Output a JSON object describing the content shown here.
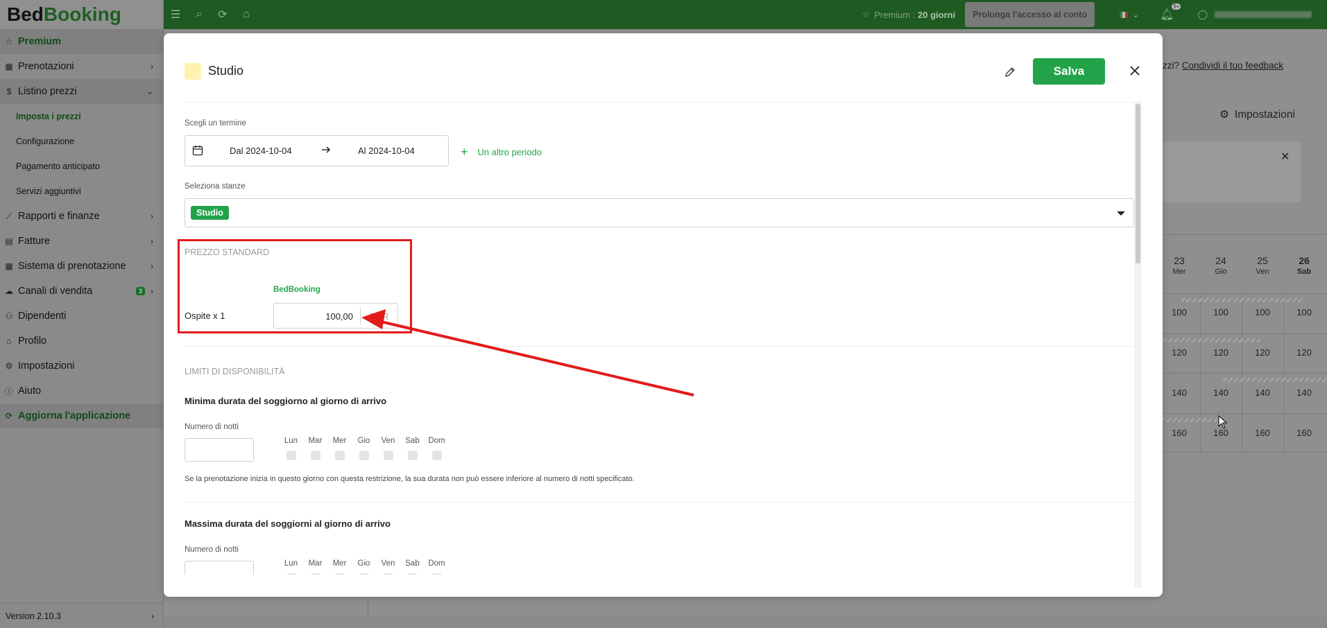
{
  "app": {
    "logo_part1": "Bed",
    "logo_part2": "Booking"
  },
  "sidebar": {
    "premium": "Premium",
    "items": [
      {
        "label": "Prenotazioni"
      },
      {
        "label": "Listino prezzi"
      },
      {
        "label": "Rapporti e finanze"
      },
      {
        "label": "Fatture"
      },
      {
        "label": "Sistema di prenotazione"
      },
      {
        "label": "Canali di vendita",
        "badge": "3"
      },
      {
        "label": "Dipendenti"
      },
      {
        "label": "Profilo"
      },
      {
        "label": "Impostazioni"
      },
      {
        "label": "Aiuto"
      }
    ],
    "subitems": [
      {
        "label": "Imposta i prezzi"
      },
      {
        "label": "Configurazione"
      },
      {
        "label": "Pagamento anticipato"
      },
      {
        "label": "Servizi aggiuntivi"
      }
    ],
    "update_app": "Aggiorna l'applicazione",
    "version": "Version 2.10.3"
  },
  "topbar": {
    "premium_prefix": "Premium : ",
    "premium_days": "20 giorni",
    "prolonga_button": "Prolunga l'accesso al conto",
    "notif_badge": "9+"
  },
  "background": {
    "feedback_prefix": "zzi? ",
    "feedback_link": "Condividi il tuo feedback",
    "settings": "Impostazioni",
    "days": [
      {
        "num": "23",
        "dow": "Mer"
      },
      {
        "num": "24",
        "dow": "Gio"
      },
      {
        "num": "25",
        "dow": "Ven"
      },
      {
        "num": "26",
        "dow": "Sab"
      }
    ],
    "rows": [
      [
        "100",
        "100",
        "100",
        "100"
      ],
      [
        "120",
        "120",
        "120",
        "120"
      ],
      [
        "140",
        "140",
        "140",
        "140"
      ],
      [
        "160",
        "160",
        "160",
        "160"
      ]
    ]
  },
  "modal": {
    "title": "Studio",
    "save_button": "Salva",
    "term_label": "Scegli un termine",
    "date_from": "Dal 2024-10-04",
    "date_to": "Al 2024-10-04",
    "add_period": "Un altro periodo",
    "rooms_label": "Seleziona stanze",
    "room_chip": "Studio",
    "standard_price_title": "PREZZO STANDARD",
    "channel_label": "BedBooking",
    "guest_label": "Ospite x 1",
    "price_value": "100,00",
    "currency": "EUR",
    "availability_title": "LIMITI DI DISPONIBILITÀ",
    "min_stay": {
      "title": "Minima durata del soggiorno al giorno di arrivo",
      "nights_label": "Numero di notti",
      "hint": "Se la prenotazione inizia in questo giorno con questa restrizione, la sua durata non può essere inferiore al numero di notti specificato."
    },
    "max_stay": {
      "title": "Massima durata del soggiorni al giorno di arrivo",
      "nights_label": "Numero di notti"
    },
    "weekdays": [
      "Lun",
      "Mar",
      "Mer",
      "Gio",
      "Ven",
      "Sab",
      "Dom"
    ]
  },
  "colors": {
    "brand_green": "#22a34a",
    "topbar_green": "#1e5a22",
    "highlight_red": "#e21b1b"
  }
}
